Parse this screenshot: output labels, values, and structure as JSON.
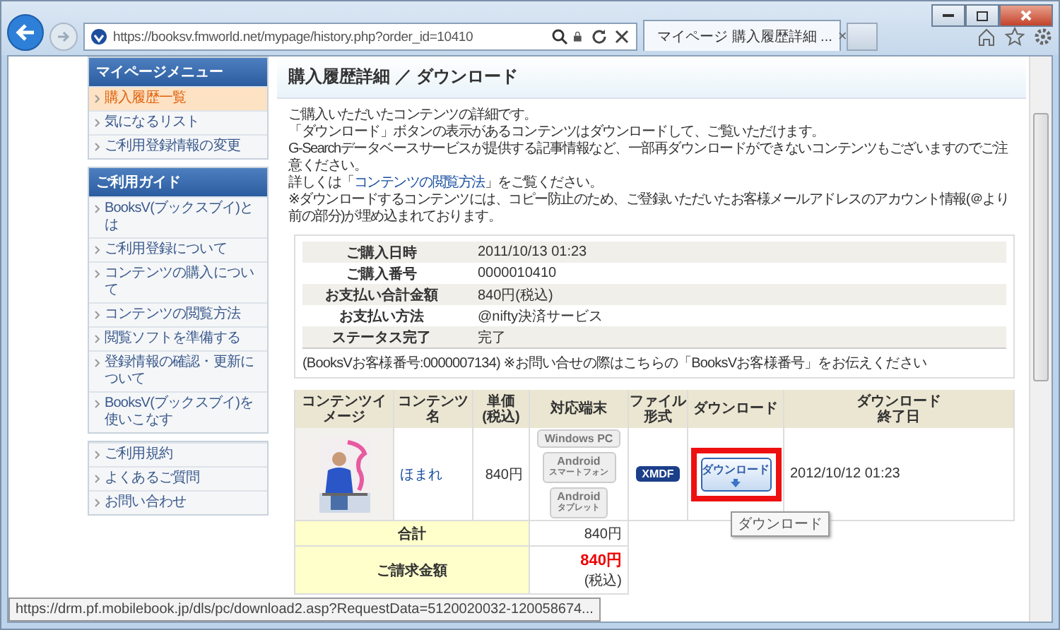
{
  "browser": {
    "url": "https://booksv.fmworld.net/mypage/history.php?order_id=10410",
    "tab_title": "マイページ 購入履歴詳細 ...",
    "tab_close": "×"
  },
  "sidebar": {
    "sections": [
      {
        "title": "マイページメニュー",
        "items": [
          {
            "label": "購入履歴一覧",
            "selected": true
          },
          {
            "label": "気になるリスト",
            "selected": false
          },
          {
            "label": "ご利用登録情報の変更",
            "selected": false
          }
        ]
      },
      {
        "title": "ご利用ガイド",
        "items": [
          {
            "label": "BooksV(ブックスブイ)とは",
            "selected": false
          },
          {
            "label": "ご利用登録について",
            "selected": false
          },
          {
            "label": "コンテンツの購入について",
            "selected": false
          },
          {
            "label": "コンテンツの閲覧方法",
            "selected": false
          },
          {
            "label": "閲覧ソフトを準備する",
            "selected": false
          },
          {
            "label": "登録情報の確認・更新について",
            "selected": false
          },
          {
            "label": "BooksV(ブックスブイ)を使いこなす",
            "selected": false
          }
        ]
      },
      {
        "items": [
          {
            "label": "ご利用規約",
            "selected": false
          },
          {
            "label": "よくあるご質問",
            "selected": false
          },
          {
            "label": "お問い合わせ",
            "selected": false
          }
        ]
      }
    ]
  },
  "main": {
    "title": "購入履歴詳細 ／ ダウンロード",
    "intro": [
      {
        "text": "ご購入いただいたコンテンツの詳細です。"
      },
      {
        "text": "「ダウンロード」ボタンの表示があるコンテンツはダウンロードして、ご覧いただけます。"
      },
      {
        "text": "G-Searchデータベースサービスが提供する記事情報など、一部再ダウンロードができないコンテンツもございますのでご注意ください。"
      },
      {
        "text": "詳しくは「",
        "link": "コンテンツの閲覧方法",
        "after": "」をご覧ください。"
      },
      {
        "text": "※ダウンロードするコンテンツには、コピー防止のため、ご登録いただいたお客様メールアドレスのアカウント情報(＠より前の部分)が埋め込まれております。"
      }
    ],
    "summary": [
      {
        "label": "ご購入日時",
        "value": "2011/10/13 01:23"
      },
      {
        "label": "ご購入番号",
        "value": "0000010410"
      },
      {
        "label": "お支払い合計金額",
        "value": "840円(税込)"
      },
      {
        "label": "お支払い方法",
        "value": "@nifty決済サービス"
      },
      {
        "label": "ステータス完了",
        "value": "完了"
      }
    ],
    "customer_note": "(BooksVお客様番号:0000007134) ※お問い合せの際はこちらの「BooksVお客様番号」をお伝えください",
    "table": {
      "columns": [
        {
          "lines": [
            "コンテンツイメージ"
          ]
        },
        {
          "lines": [
            "コンテンツ名"
          ]
        },
        {
          "lines": [
            "単価",
            "(税込)"
          ]
        },
        {
          "lines": [
            "対応端末"
          ]
        },
        {
          "lines": [
            "ファイル",
            "形式"
          ]
        },
        {
          "lines": [
            "ダウンロード"
          ]
        },
        {
          "lines": [
            "ダウンロード",
            "終了日"
          ]
        }
      ],
      "rows": [
        {
          "title": "ほまれ",
          "price": "840円",
          "devices": [
            {
              "name": "Windows PC"
            },
            {
              "name": "Android",
              "sub": "スマートフォン"
            },
            {
              "name": "Android",
              "sub": "タブレット"
            }
          ],
          "format": "XMDF",
          "download": "ダウンロード",
          "highlighted": true,
          "end_date": "2012/10/12 01:23"
        }
      ],
      "total": {
        "label": "合計",
        "value": "840円"
      },
      "billing": {
        "label": "ご請求金額",
        "amount": "840円",
        "tax": "(税込)"
      }
    },
    "tooltip": "ダウンロード"
  },
  "status_url": "https://drm.pf.mobilebook.jp/dls/pc/download2.asp?RequestData=5120020032-120058674..."
}
